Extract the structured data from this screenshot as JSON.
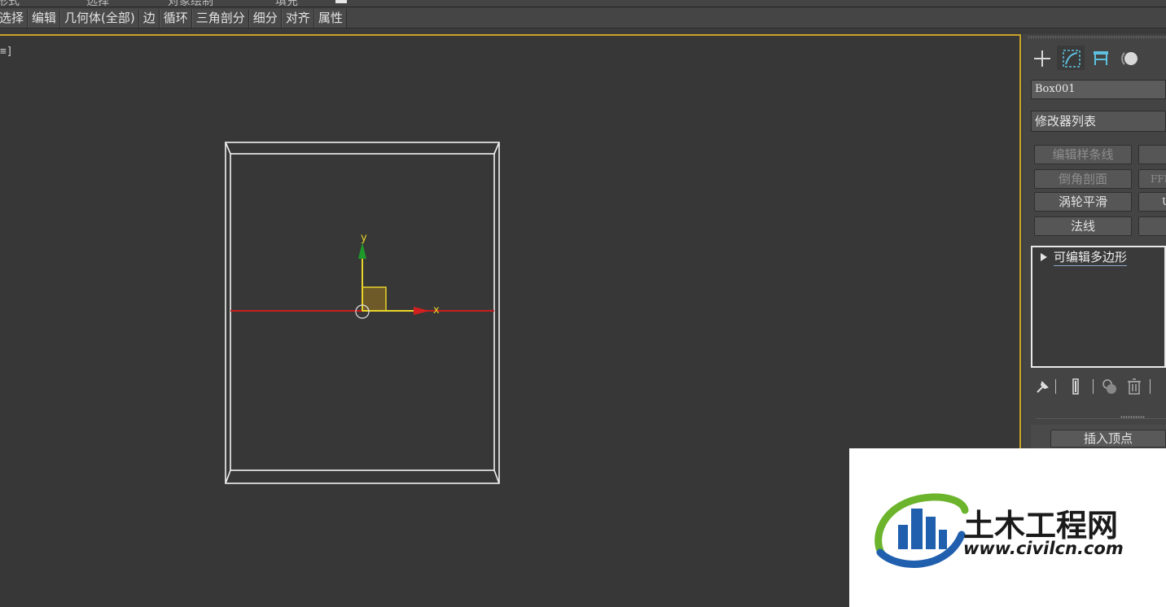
{
  "ribbon_partial": [
    "形式",
    "选择",
    "对象绘制",
    "填充"
  ],
  "toolbar": {
    "items": [
      "选择",
      "编辑",
      "几何体(全部)",
      "边",
      "循环",
      "三角剖分",
      "细分",
      "对齐",
      "属性"
    ]
  },
  "viewport": {
    "label": "≡]",
    "gizmo": {
      "x_label": "x",
      "y_label": "y"
    }
  },
  "command_panel": {
    "tabs": [
      "create-tab",
      "modify-tab",
      "hierarchy-tab",
      "motion-tab"
    ],
    "object_name": "Box001",
    "modifier_list": "修改器列表",
    "modifier_buttons": [
      {
        "label": "编辑样条线",
        "enabled": false
      },
      {
        "label": "倒角剖面",
        "enabled": false
      },
      {
        "label": "FFD",
        "enabled": false
      },
      {
        "label": "涡轮平滑",
        "enabled": true
      },
      {
        "label": "U",
        "enabled": true
      },
      {
        "label": "法线",
        "enabled": true
      }
    ],
    "stack": {
      "items": [
        "可编辑多边形"
      ]
    },
    "rollout": {
      "insert_vertex": "插入顶点"
    }
  },
  "watermark": {
    "title": "土木工程网",
    "url": "www.civilcn.com",
    "colors": {
      "blue": "#1f5fae",
      "green": "#6bb42b",
      "text": "#1a1a1a"
    }
  }
}
